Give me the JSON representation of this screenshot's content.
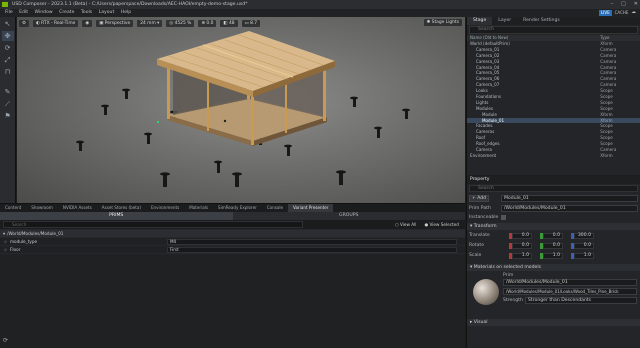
{
  "window": {
    "title": "USD Composer - 2023.1.1 (Beta) - C:/Users/paperspace/Downloads/AEC-HAOI/empty-demo-stage.usd*"
  },
  "menu": [
    "File",
    "Edit",
    "Window",
    "Create",
    "Tools",
    "Layout",
    "Help"
  ],
  "menu_right": {
    "live": "LIVE",
    "cache": "CACHE"
  },
  "viewport": {
    "render_mode": "RTX - Real-Time",
    "camera": "Perspective",
    "focal": "24 mm",
    "resolution": "4525 %",
    "field_a": "0.0",
    "field_b": "48",
    "field_c": "8.7",
    "stage_lights": "Stage Lights"
  },
  "stage": {
    "tabs": [
      "Stage",
      "Layer",
      "Render Settings"
    ],
    "search_placeholder": "Search",
    "columns": [
      "Name (Old to New)",
      "Type"
    ],
    "rows": [
      {
        "name": "World (defaultPrim)",
        "type": "Xform",
        "indent": 0
      },
      {
        "name": "Camera_01",
        "type": "Camera",
        "indent": 1
      },
      {
        "name": "Camera_02",
        "type": "Camera",
        "indent": 1
      },
      {
        "name": "Camera_03",
        "type": "Camera",
        "indent": 1
      },
      {
        "name": "Camera_04",
        "type": "Camera",
        "indent": 1
      },
      {
        "name": "Camera_05",
        "type": "Camera",
        "indent": 1
      },
      {
        "name": "Camera_06",
        "type": "Camera",
        "indent": 1
      },
      {
        "name": "Camera_07",
        "type": "Camera",
        "indent": 1
      },
      {
        "name": "Looks",
        "type": "Scope",
        "indent": 1
      },
      {
        "name": "Foundations",
        "type": "Scope",
        "indent": 1
      },
      {
        "name": "Lights",
        "type": "Scope",
        "indent": 1
      },
      {
        "name": "Modules",
        "type": "Scope",
        "indent": 1
      },
      {
        "name": "Module",
        "type": "Xform",
        "indent": 2
      },
      {
        "name": "Module_01",
        "type": "Xform",
        "indent": 2
      },
      {
        "name": "Facades",
        "type": "Scope",
        "indent": 1
      },
      {
        "name": "Cameras",
        "type": "Scope",
        "indent": 1
      },
      {
        "name": "Roof",
        "type": "Scope",
        "indent": 1
      },
      {
        "name": "Roof_edges",
        "type": "Scope",
        "indent": 1
      },
      {
        "name": "Camera",
        "type": "Camera",
        "indent": 1
      },
      {
        "name": "Environment",
        "type": "Xform",
        "indent": 0
      }
    ],
    "selected_index": 13
  },
  "property": {
    "tab": "Property",
    "search_placeholder": "Search",
    "add_label": "+ Add",
    "name_value": "Module_01",
    "prim_path_label": "Prim Path",
    "prim_path": "/World/Modules/Module_01",
    "instanceable_label": "Instanceable",
    "transform_label": "Transform",
    "translate_label": "Translate",
    "rotate_label": "Rotate",
    "scale_label": "Scale",
    "translate": [
      "0.0",
      "0.0",
      "300.0"
    ],
    "rotate": [
      "0.0",
      "0.0",
      "0.0"
    ],
    "scale": [
      "1.0",
      "1.0",
      "1.0"
    ],
    "materials_label": "Materials on selected models",
    "prim_label": "Prim",
    "material_prim": "/World/Modules/Module_01",
    "material_path": "/World/Modules/Module_01/Looks/Wood_Tiles_Pine_Brick",
    "strength_label": "Strength",
    "strength_value": "Stronger than Descendants",
    "visual_label": "Visual"
  },
  "bottom": {
    "tabs": [
      "Content",
      "Showroom",
      "NVIDIA Assets",
      "Asset Stores (beta)",
      "Environments",
      "Materials",
      "SimReady Explorer",
      "Console",
      "Variant Presenter"
    ],
    "active_tab": 8,
    "subtabs": [
      "PRIMS",
      "GROUPS"
    ],
    "filter_placeholder": "Search",
    "view_all": "View All",
    "view_selected": "View Selected",
    "section": "/World/Modules/Module_01",
    "rows": [
      {
        "name": "module_type",
        "value": "M4"
      },
      {
        "name": "Floor",
        "value": "First"
      }
    ]
  },
  "colors": {
    "accent": "#2d6fb6",
    "selection": "#3a4a5e"
  }
}
